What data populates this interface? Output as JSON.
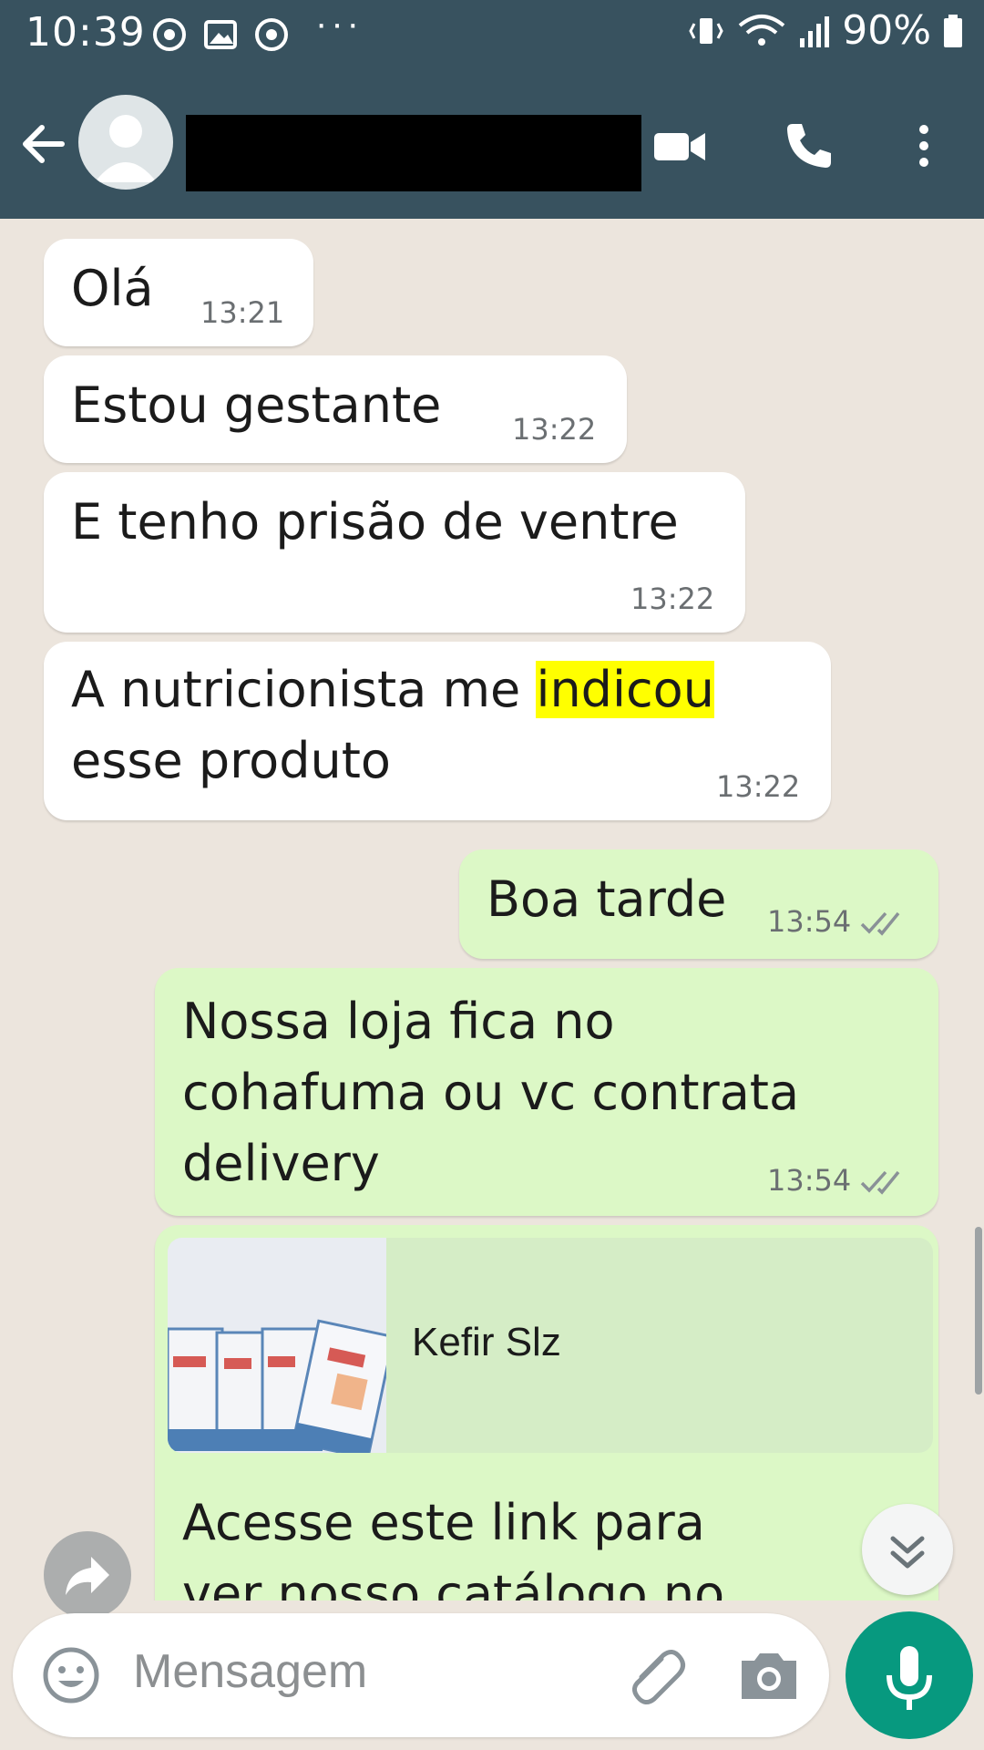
{
  "status_bar": {
    "time": "10:39",
    "overflow": "···",
    "battery": "90%",
    "icons": [
      "chrome-icon",
      "gallery-icon",
      "chrome-icon",
      "vibrate-icon",
      "wifi-icon",
      "signal-icon",
      "battery-icon"
    ]
  },
  "header": {
    "icons": [
      "back-arrow-icon",
      "avatar-icon",
      "video-call-icon",
      "phone-icon",
      "more-vert-icon"
    ]
  },
  "messages": [
    {
      "direction": "in",
      "text": "Olá",
      "time": "13:21"
    },
    {
      "direction": "in",
      "text": "Estou gestante",
      "time": "13:22"
    },
    {
      "direction": "in",
      "text": "E tenho prisão de ventre",
      "time": "13:22"
    },
    {
      "direction": "in",
      "text_before": "A nutricionista me ",
      "highlight": "indicou",
      "text_after": "esse produto",
      "time": "13:22"
    },
    {
      "direction": "out",
      "text": "Boa tarde",
      "time": "13:54",
      "status": "read"
    },
    {
      "direction": "out",
      "lines": [
        "Nossa loja fica no",
        "cohafuma ou vc contrata",
        "delivery"
      ],
      "time": "13:54",
      "status": "read"
    },
    {
      "direction": "out",
      "link_preview_title": "Kefir Slz",
      "lines": [
        "Acesse este link para",
        "ver nosso catálogo no"
      ]
    }
  ],
  "input": {
    "placeholder": "Mensagem"
  },
  "colors": {
    "header": "#38525f",
    "chat_bg": "#ece5dd",
    "incoming": "#ffffff",
    "outgoing": "#dcf8c6",
    "highlight": "#ffff00",
    "mic": "#07997f"
  }
}
